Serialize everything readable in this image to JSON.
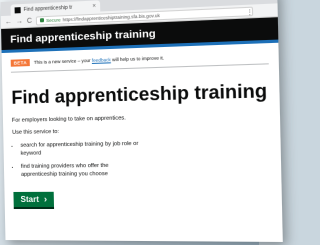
{
  "browser": {
    "tab_title": "Find apprenticeship tr",
    "tab_close": "×",
    "nav": {
      "back": "←",
      "forward": "→",
      "reload": "C"
    },
    "secure_label": "Secure",
    "url": "https://findapprenticeshiptraining.sfa.bis.gov.uk",
    "menu": "⋮",
    "window_controls": [
      "–",
      "□",
      "×"
    ]
  },
  "gov_header": {
    "service_name": "Find apprenticeship training"
  },
  "phase_banner": {
    "tag": "BETA",
    "text_before": "This is a new service – your ",
    "link_text": "feedback",
    "text_after": " will help us to improve it."
  },
  "main": {
    "title": "Find apprenticeship training",
    "lead": "For employers looking to take on apprentices.",
    "intro": "Use this service to:",
    "bullets": [
      "search for apprenticeship training by job role or keyword",
      "find training providers who offer the apprenticeship training you choose"
    ],
    "start_button": "Start",
    "start_chevron": "›"
  },
  "colors": {
    "gov_black": "#0b0c0c",
    "gov_blue": "#1d70b8",
    "beta_orange": "#f47738",
    "start_green": "#00703c"
  }
}
